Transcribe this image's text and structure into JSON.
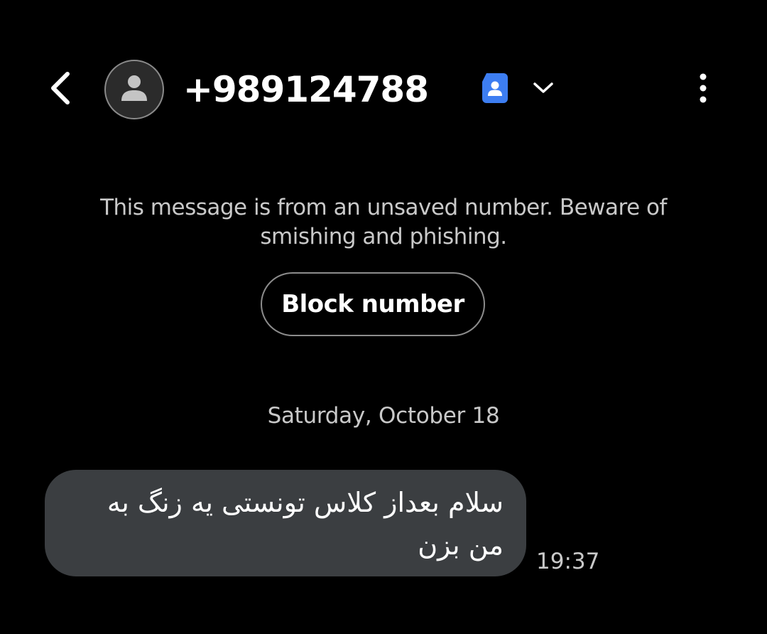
{
  "header": {
    "back_icon": "chevron-left-icon",
    "avatar_icon": "person-icon",
    "title": "+989124788",
    "contact_card_icon": "contact-card-icon",
    "accent": "#3d7ef2",
    "dropdown_icon": "chevron-down-icon",
    "more_icon": "more-vertical-icon"
  },
  "warning": {
    "text": "This message is from an unsaved number. Beware of smishing and phishing.",
    "block_label": "Block number"
  },
  "conversation": {
    "date": "Saturday, October 18",
    "messages": [
      {
        "text": "سلام بعداز کلاس تونستی یه زنگ به من بزن",
        "time": "19:37",
        "bubble_color": "#3b3e41"
      }
    ]
  }
}
